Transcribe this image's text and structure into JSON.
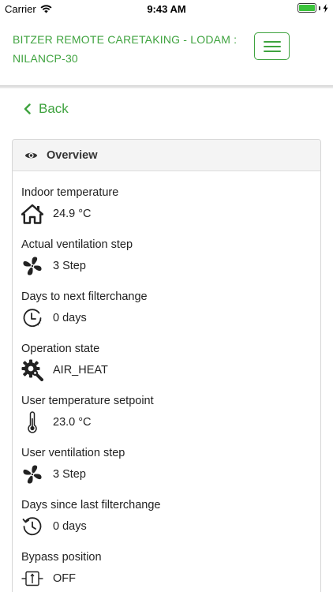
{
  "status_bar": {
    "carrier": "Carrier",
    "time": "9:43 AM",
    "battery_level": 1.0
  },
  "header": {
    "title": "BITZER REMOTE CARETAKING - LODAM : NILANCP-30",
    "menu_icon": "hamburger-menu-icon"
  },
  "back": {
    "label": "Back",
    "icon": "chevron-left-icon"
  },
  "overview": {
    "title": "Overview",
    "icon": "eye-icon",
    "items": [
      {
        "label": "Indoor temperature",
        "value": "24.9 °C",
        "icon": "home-icon"
      },
      {
        "label": "Actual ventilation step",
        "value": "3 Step",
        "icon": "fan-icon"
      },
      {
        "label": "Days to next filterchange",
        "value": "0 days",
        "icon": "clock-forward-icon"
      },
      {
        "label": "Operation state",
        "value": "AIR_HEAT",
        "icon": "gear-wrench-icon"
      },
      {
        "label": "User temperature setpoint",
        "value": "23.0 °C",
        "icon": "thermometer-icon"
      },
      {
        "label": "User ventilation step",
        "value": "3 Step",
        "icon": "fan-icon"
      },
      {
        "label": "Days since last filterchange",
        "value": "0 days",
        "icon": "history-icon"
      },
      {
        "label": "Bypass position",
        "value": "OFF",
        "icon": "bypass-valve-icon"
      }
    ]
  },
  "colors": {
    "accent": "#3fa33f",
    "battery": "#3bc43b"
  }
}
